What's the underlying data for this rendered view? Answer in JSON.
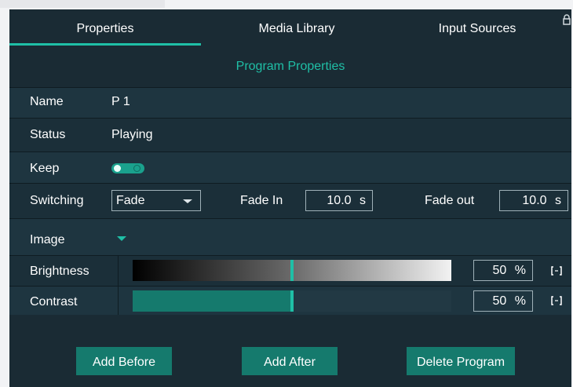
{
  "tabs": [
    {
      "label": "Properties",
      "active": true
    },
    {
      "label": "Media Library",
      "active": false
    },
    {
      "label": "Input Sources",
      "active": false
    }
  ],
  "section_title": "Program Properties",
  "fields": {
    "name": {
      "label": "Name",
      "value": "P 1"
    },
    "status": {
      "label": "Status",
      "value": "Playing"
    },
    "keep": {
      "label": "Keep",
      "enabled": true
    },
    "switching": {
      "label": "Switching",
      "value": "Fade",
      "fade_in_label": "Fade In",
      "fade_in_value": "10.0",
      "fade_in_unit": "s",
      "fade_out_label": "Fade out",
      "fade_out_value": "10.0",
      "fade_out_unit": "s"
    },
    "image": {
      "label": "Image"
    },
    "brightness": {
      "label": "Brightness",
      "value": "50",
      "unit": "%",
      "level": 0.5
    },
    "contrast": {
      "label": "Contrast",
      "value": "50",
      "unit": "%",
      "level": 0.5
    }
  },
  "buttons": {
    "add_before": "Add Before",
    "add_after": "Add After",
    "delete_program": "Delete Program"
  },
  "icons": [
    "lock-icon",
    "toggle-switch",
    "chevron-down-icon",
    "reset-icon"
  ],
  "colors": {
    "accent": "#1fbfa6",
    "panel_bg": "#1a2b34",
    "row_bg": "#1e3540",
    "button_bg": "#157a6d"
  }
}
